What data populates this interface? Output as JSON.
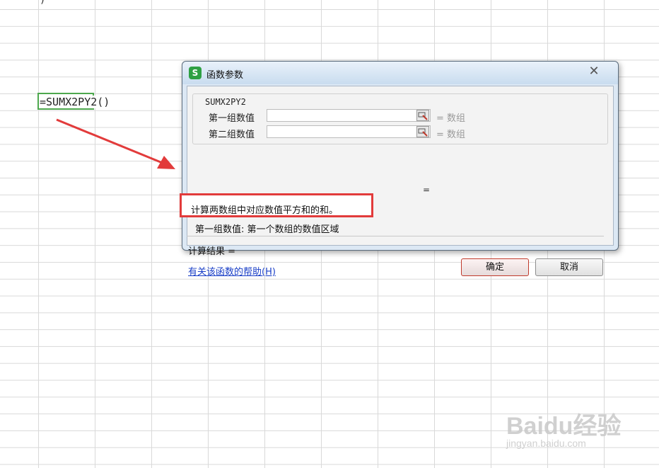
{
  "sheet": {
    "prev_cell_text": ")",
    "formula": "=SUMX2PY2()"
  },
  "dialog": {
    "title": "函数参数",
    "app_icon_text": "S",
    "close_icon": "close-icon",
    "function_name": "SUMX2PY2",
    "args": [
      {
        "label": "第一组数值",
        "value": "",
        "result": "= 数组"
      },
      {
        "label": "第二组数值",
        "value": "",
        "result": "= 数组"
      }
    ],
    "formula_result_eq": "=",
    "description": "计算两数组中对应数值平方和的和。",
    "param_description": "第一组数值:  第一个数组的数值区域",
    "calc_result_label": "计算结果 =",
    "help_link": "有关该函数的帮助(H)",
    "ok_label": "确定",
    "cancel_label": "取消"
  },
  "annotation": {
    "arrow_color": "#e23b3b",
    "highlight_color": "#e23b3b"
  },
  "watermark": {
    "main": "Baidu经验",
    "sub": "jingyan.baidu.com"
  }
}
